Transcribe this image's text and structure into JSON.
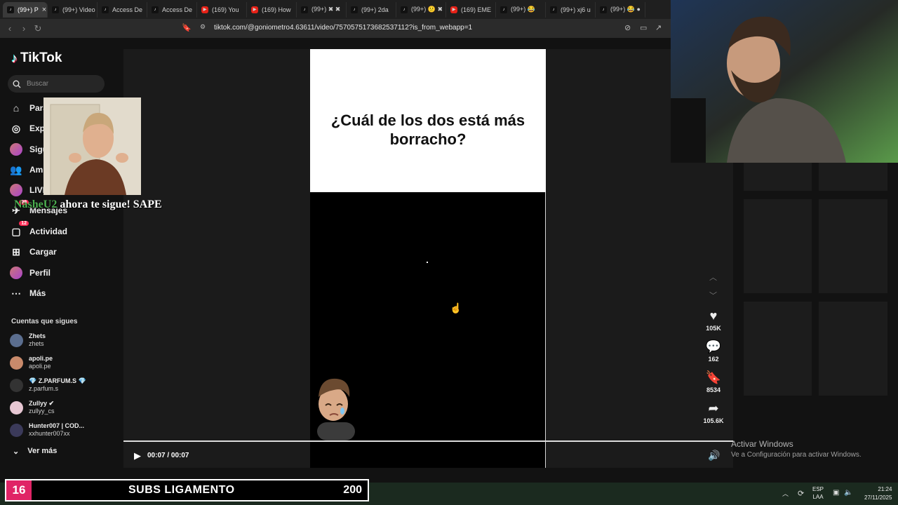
{
  "browser": {
    "tabs": [
      {
        "label": "(99+) P",
        "kind": "tt",
        "active": true
      },
      {
        "label": "(99+) Video",
        "kind": "tt"
      },
      {
        "label": "Access De",
        "kind": "tt"
      },
      {
        "label": "Access De",
        "kind": "tt"
      },
      {
        "label": "(169) You",
        "kind": "yt"
      },
      {
        "label": "(169) How",
        "kind": "yt"
      },
      {
        "label": "(99+) ✖ ✖",
        "kind": "tt"
      },
      {
        "label": "(99+) 2da",
        "kind": "tt"
      },
      {
        "label": "(99+) 😕 ✖",
        "kind": "tt"
      },
      {
        "label": "(169) EME",
        "kind": "yt"
      },
      {
        "label": "(99+) 😂",
        "kind": "tt"
      },
      {
        "label": "(99+) xj6 u",
        "kind": "tt"
      },
      {
        "label": "(99+) 😂 ●",
        "kind": "tt"
      }
    ],
    "url": "tiktok.com/@goniometro4.63611/video/7570575173682537112?is_from_webapp=1"
  },
  "sidebar": {
    "logo": "TikTok",
    "search_placeholder": "Buscar",
    "nav": [
      {
        "label": "Para ti",
        "icon": "home-icon"
      },
      {
        "label": "Explorar",
        "icon": "compass-icon"
      },
      {
        "label": "Siguiendo",
        "icon": "following-icon"
      },
      {
        "label": "Amigos",
        "icon": "friends-icon"
      },
      {
        "label": "LIVE",
        "icon": "live-icon"
      },
      {
        "label": "Mensajes",
        "icon": "messages-icon",
        "badge": "99"
      },
      {
        "label": "Actividad",
        "icon": "activity-icon",
        "badge": "12"
      },
      {
        "label": "Cargar",
        "icon": "upload-icon"
      },
      {
        "label": "Perfil",
        "icon": "profile-icon"
      },
      {
        "label": "Más",
        "icon": "more-icon"
      }
    ],
    "following_title": "Cuentas que sigues",
    "following": [
      {
        "name": "Zhets",
        "handle": "zhets",
        "color": "#5b6e8f"
      },
      {
        "name": "apoli.pe",
        "handle": "apoli.pe",
        "color": "#c98a6b"
      },
      {
        "name": "💎 Z.PARFUM.S 💎",
        "handle": "z.parfum.s",
        "color": "#333333"
      },
      {
        "name": "Zullyy ✔",
        "handle": "zullyy_cs",
        "color": "#e7c7d3"
      },
      {
        "name": "Hunter007 | COD...",
        "handle": "xxhunter007xx",
        "color": "#3b3a5a"
      }
    ],
    "see_more": "Ver más"
  },
  "video": {
    "question": "¿Cuál de los dos está más borracho?",
    "time": "00:07 / 00:07",
    "progress_percent": 100
  },
  "actions": {
    "likes": "105K",
    "comments": "162",
    "saves": "8534",
    "shares": "105.6K"
  },
  "overlay": {
    "follower": "NasheU2",
    "follow_text": "ahora te sigue! SAPE"
  },
  "watermark": {
    "line1": "Activar Windows",
    "line2": "Ve a Configuración para activar Windows."
  },
  "subs_bar": {
    "count": "16",
    "label": "SUBS LIGAMENTO",
    "goal": "200"
  },
  "taskbar": {
    "lang1": "ESP",
    "lang2": "LAA",
    "time": "21:24",
    "date": "27/11/2025"
  }
}
